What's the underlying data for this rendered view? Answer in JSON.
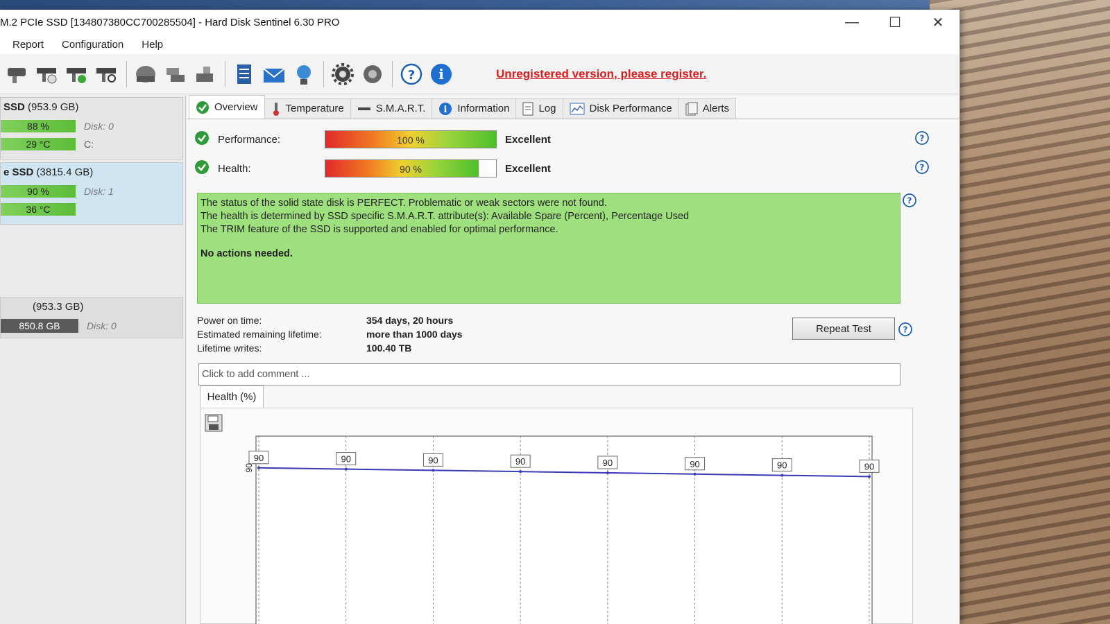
{
  "window": {
    "title": "M.2 PCIe SSD [134807380CC700285504]  -  Hard Disk Sentinel 6.30 PRO",
    "controls": [
      "—",
      "☐",
      "✕"
    ]
  },
  "menu": [
    "Report",
    "Configuration",
    "Help"
  ],
  "toolbar": {
    "register_text": "Unregistered version, please register."
  },
  "disks": [
    {
      "name": "SSD",
      "size": "(953.9 GB)",
      "health": "88 %",
      "temp": "29 °C",
      "disk": "Disk: 0",
      "drive": "C:"
    },
    {
      "name": "e SSD",
      "size": "(3815.4 GB)",
      "health": "90 %",
      "temp": "36 °C",
      "disk": "Disk: 1"
    }
  ],
  "volume": {
    "size": "(953.3 GB)",
    "free": "850.8 GB",
    "disk": "Disk: 0"
  },
  "tabs": [
    "Overview",
    "Temperature",
    "S.M.A.R.T.",
    "Information",
    "Log",
    "Disk Performance",
    "Alerts"
  ],
  "performance": {
    "label": "Performance:",
    "value": 100,
    "text": "100 %",
    "status": "Excellent"
  },
  "health": {
    "label": "Health:",
    "value": 90,
    "text": "90 %",
    "status": "Excellent"
  },
  "status_lines": [
    "The status of the solid state disk is PERFECT. Problematic or weak sectors were not found.",
    "The health is determined by SSD specific S.M.A.R.T. attribute(s):  Available Spare (Percent), Percentage Used",
    "The TRIM feature of the SSD is supported and enabled for optimal performance."
  ],
  "status_action": "No actions needed.",
  "info": {
    "power_on_label": "Power on time:",
    "power_on_value": "354 days, 20 hours",
    "lifetime_label": "Estimated remaining lifetime:",
    "lifetime_value": "more than 1000 days",
    "writes_label": "Lifetime writes:",
    "writes_value": "100.40 TB"
  },
  "repeat_test": "Repeat Test",
  "comment_placeholder": "Click to add comment ...",
  "chart_tab": "Health (%)",
  "chart_data": {
    "type": "line",
    "title": "",
    "x": [
      1,
      2,
      3,
      4,
      5,
      6,
      7,
      8
    ],
    "series": [
      {
        "values": [
          90,
          90,
          90,
          90,
          90,
          90,
          90,
          90
        ]
      }
    ],
    "y_tick": "90",
    "color": "#3a3ab8"
  }
}
